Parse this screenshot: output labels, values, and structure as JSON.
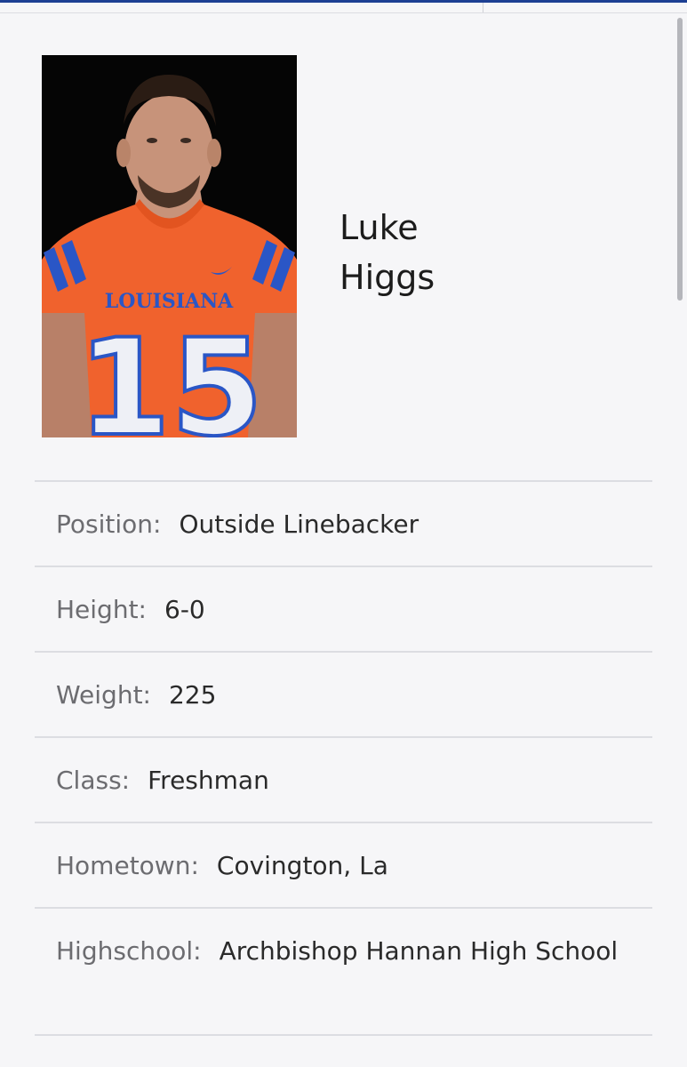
{
  "colors": {
    "accent": "#1d3f93",
    "jersey": "#f0622d",
    "jersey_trim": "#2a56c6",
    "label": "#6c6c70",
    "divider": "#dcdde2"
  },
  "player": {
    "first_name": "Luke",
    "last_name": "Higgs",
    "photo": {
      "jersey_text": "LOUISIANA",
      "jersey_number": "15"
    }
  },
  "details": [
    {
      "label": "Position:",
      "value": "Outside Linebacker"
    },
    {
      "label": "Height:",
      "value": "6-0"
    },
    {
      "label": "Weight:",
      "value": "225"
    },
    {
      "label": "Class:",
      "value": "Freshman"
    },
    {
      "label": "Hometown:",
      "value": "Covington, La"
    },
    {
      "label": "Highschool:",
      "value": "Archbishop Hannan High School"
    }
  ]
}
